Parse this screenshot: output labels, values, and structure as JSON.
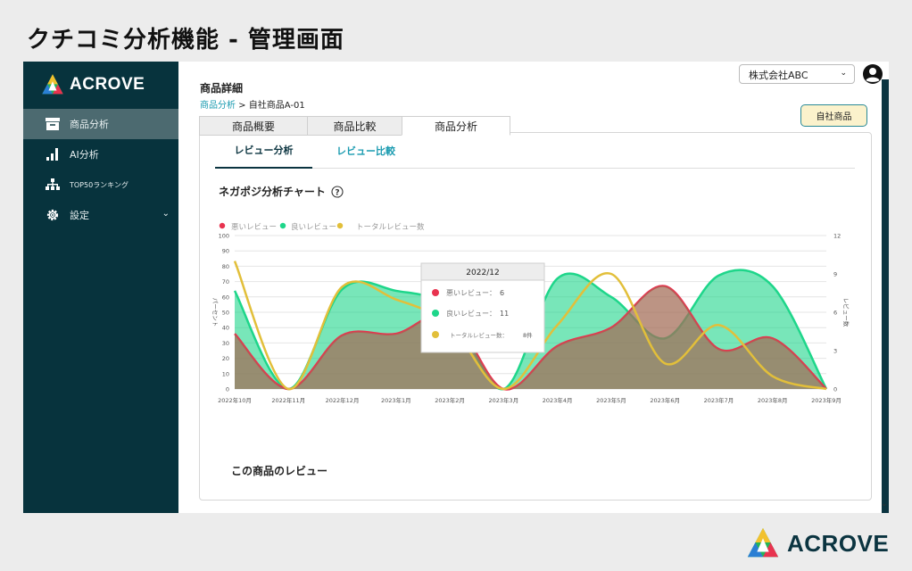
{
  "slide": {
    "title": "クチコミ分析機能 - 管理画面"
  },
  "brand": {
    "name": "ACROVE"
  },
  "sidebar": {
    "items": [
      {
        "label": "商品分析",
        "icon": "archive-box-icon",
        "active": true
      },
      {
        "label": "AI分析",
        "icon": "bar-chart-icon",
        "active": false
      },
      {
        "label": "TOP50ランキング",
        "icon": "org-chart-icon",
        "active": false
      },
      {
        "label": "設定",
        "icon": "gear-icon",
        "active": false
      }
    ]
  },
  "header": {
    "company_select": "株式会社ABC",
    "page_title": "商品詳細",
    "breadcrumb_link": "商品分析",
    "breadcrumb_sep": " > ",
    "breadcrumb_current": "自社商品A-01",
    "own_product_button": "自社商品"
  },
  "tabs": [
    {
      "label": "商品概要"
    },
    {
      "label": "商品比較"
    },
    {
      "label": "商品分析"
    }
  ],
  "subtabs": [
    {
      "label": "レビュー分析"
    },
    {
      "label": "レビュー比較"
    }
  ],
  "chart_title": "ネガポジ分析チャート",
  "reviews_heading": "この商品のレビュー",
  "colors": {
    "bad": "#e8334f",
    "good": "#1ed68a",
    "total": "#e2bf3a",
    "sidebar": "#07333d",
    "accent": "#1a9bb0"
  },
  "chart_data": {
    "type": "area",
    "categories": [
      "2022年10月",
      "2022年11月",
      "2022年12月",
      "2023年1月",
      "2023年2月",
      "2023年3月",
      "2023年4月",
      "2023年5月",
      "2023年6月",
      "2023年7月",
      "2023年8月",
      "2023年9月"
    ],
    "series": [
      {
        "name": "悪いレビュー",
        "axis": "left",
        "values": [
          36,
          0,
          35,
          36,
          48,
          0,
          28,
          40,
          67,
          26,
          33,
          0
        ]
      },
      {
        "name": "良いレビュー",
        "axis": "left",
        "values": [
          64,
          0,
          65,
          64,
          52,
          0,
          72,
          60,
          33,
          74,
          67,
          0
        ]
      },
      {
        "name": "トータルレビュー数",
        "axis": "right",
        "values": [
          10,
          0,
          8,
          7,
          5,
          0,
          5,
          9,
          2,
          5,
          1,
          0
        ]
      }
    ],
    "ylabel": "パーセント",
    "y2label": "レビュー数",
    "ylim": [
      0,
      100
    ],
    "yticks": [
      0,
      10,
      20,
      30,
      40,
      50,
      60,
      70,
      80,
      90,
      100
    ],
    "y2lim": [
      0,
      12
    ],
    "y2ticks": [
      0,
      3,
      6,
      9,
      12
    ],
    "legend": "top-left",
    "grid": true,
    "tooltip": {
      "title": "2022/12",
      "rows": [
        {
          "label": "悪いレビュー：",
          "value": "6"
        },
        {
          "label": "良いレビュー：",
          "value": "11"
        },
        {
          "label": "トータルレビュー数：",
          "value": "8件"
        }
      ]
    }
  }
}
